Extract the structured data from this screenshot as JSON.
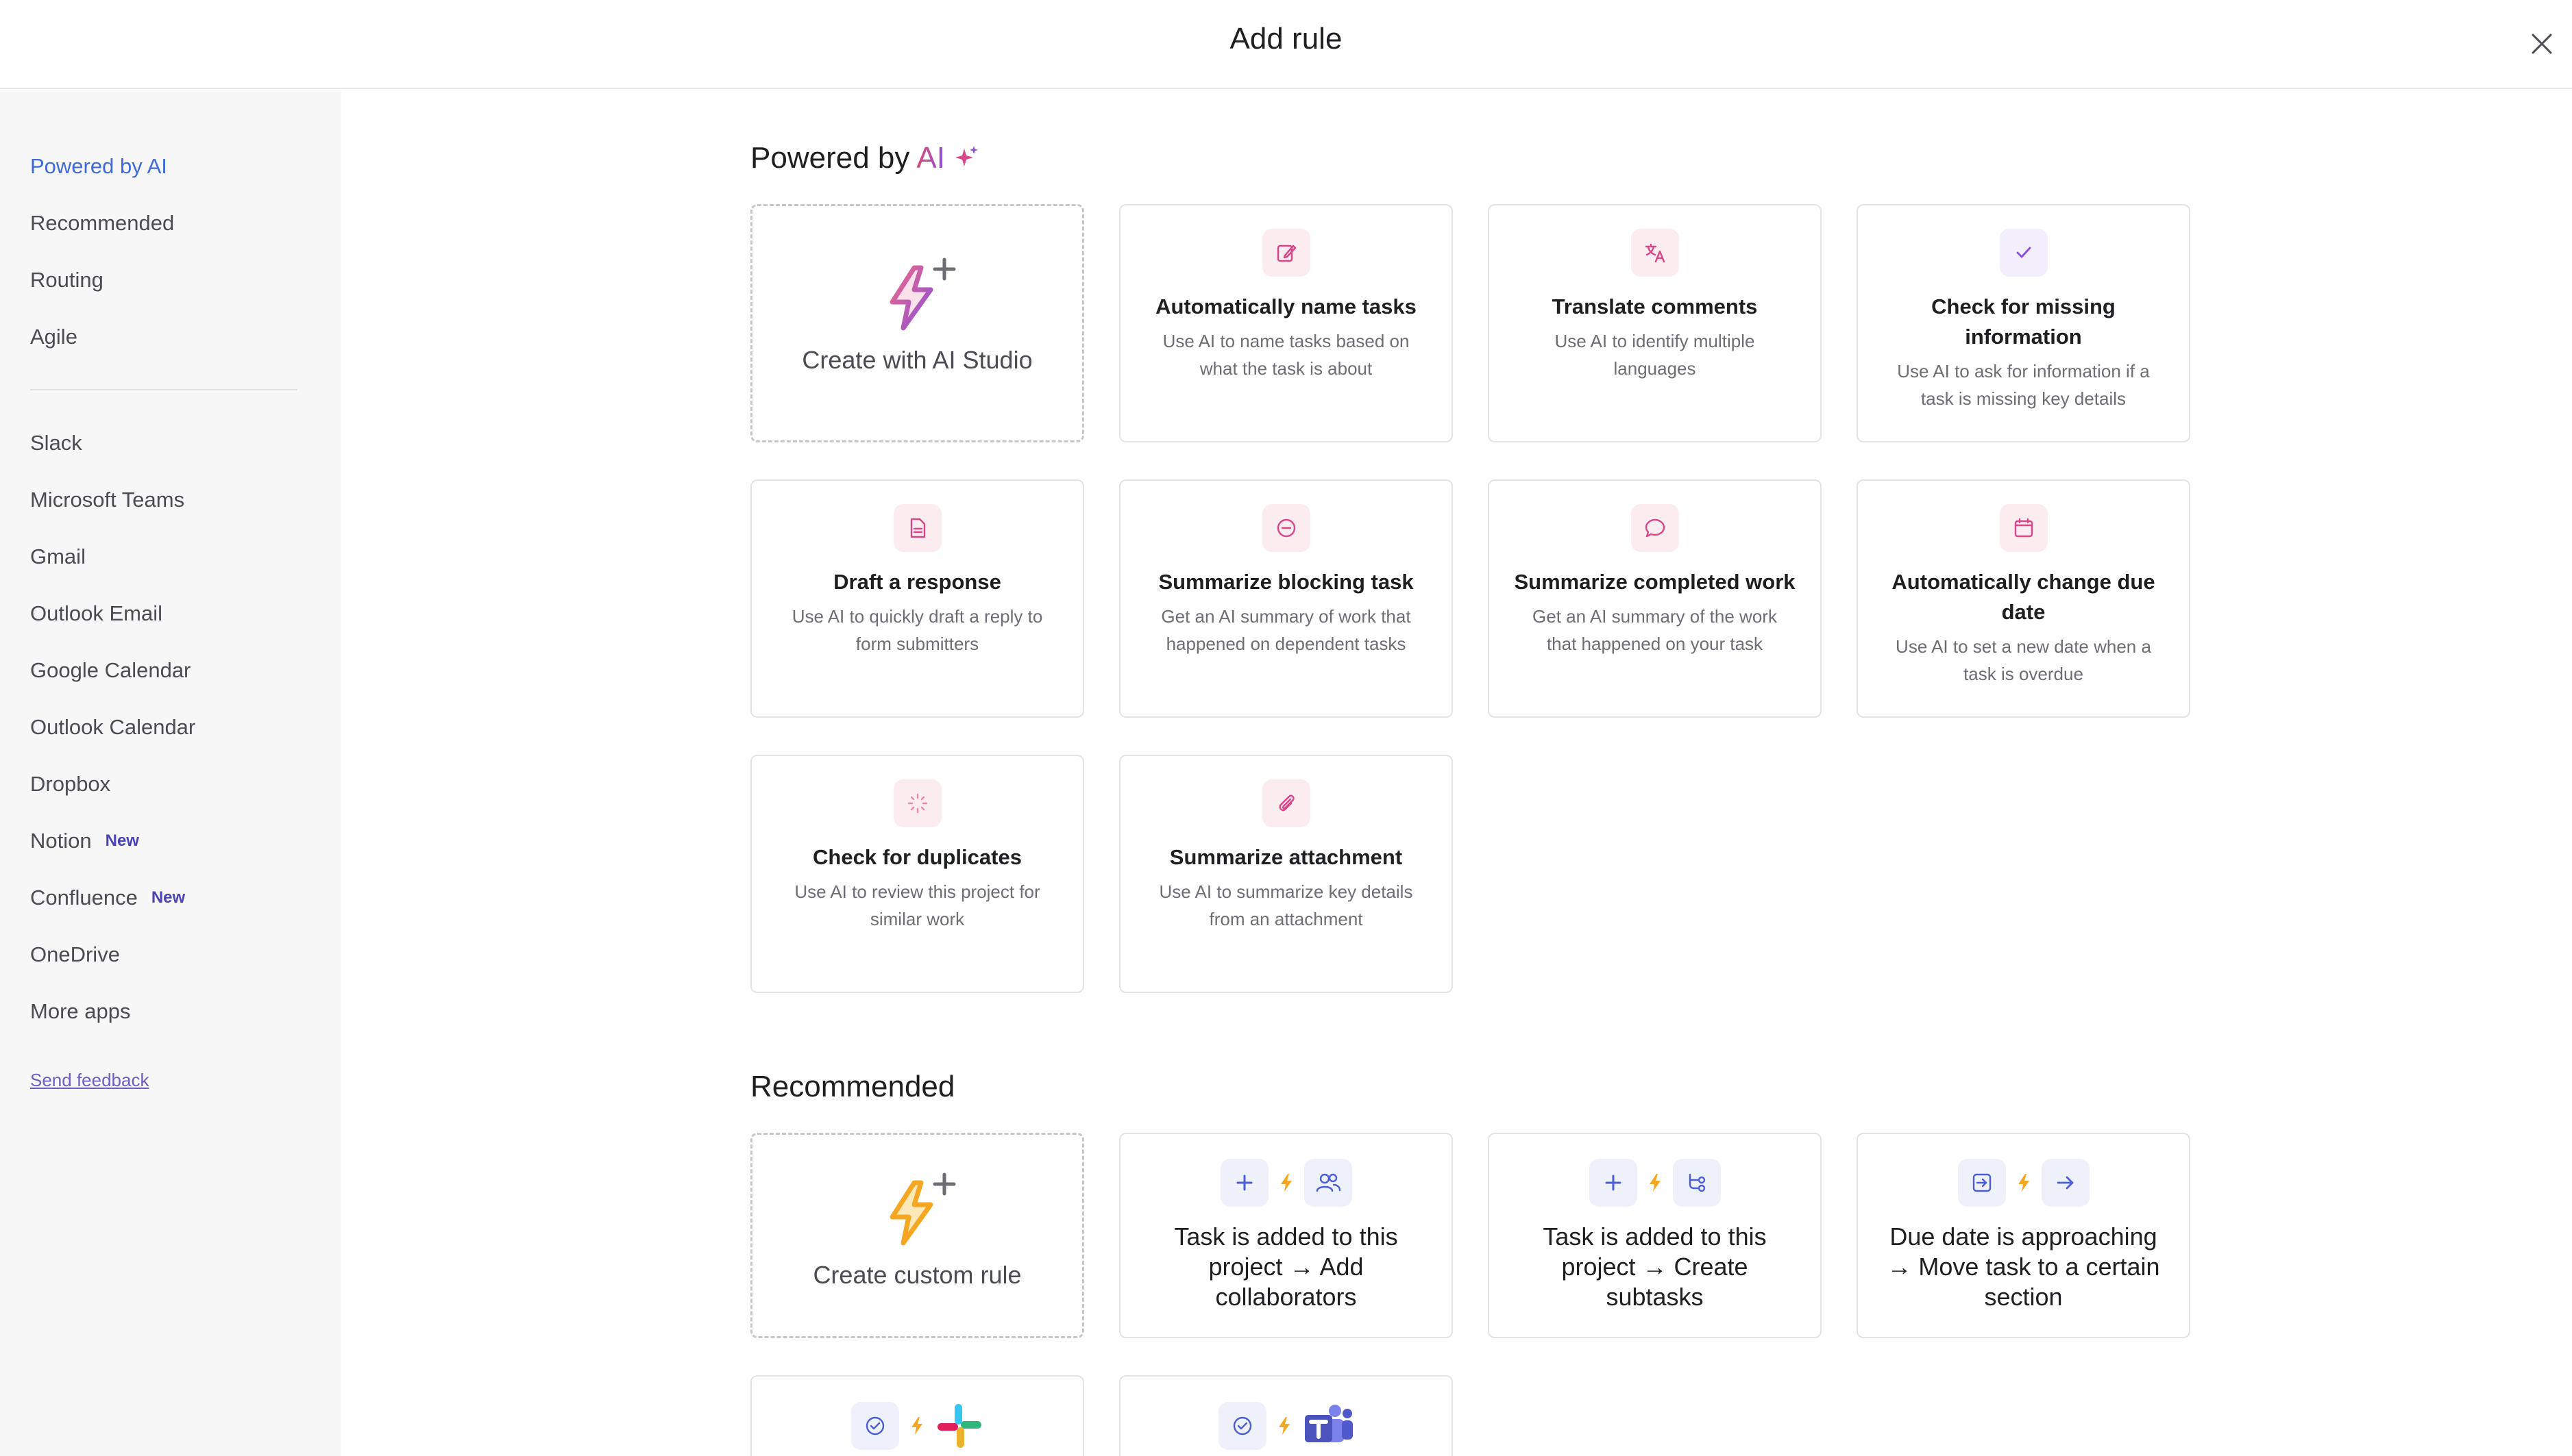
{
  "header": {
    "title": "Add rule"
  },
  "sidebar": {
    "items": [
      {
        "label": "Powered by AI"
      },
      {
        "label": "Recommended"
      },
      {
        "label": "Routing"
      },
      {
        "label": "Agile"
      },
      {
        "label": "Slack"
      },
      {
        "label": "Microsoft Teams"
      },
      {
        "label": "Gmail"
      },
      {
        "label": "Outlook Email"
      },
      {
        "label": "Google Calendar"
      },
      {
        "label": "Outlook Calendar"
      },
      {
        "label": "Dropbox"
      },
      {
        "label": "Notion",
        "badge": "New"
      },
      {
        "label": "Confluence",
        "badge": "New"
      },
      {
        "label": "OneDrive"
      },
      {
        "label": "More apps"
      }
    ],
    "feedback": "Send feedback"
  },
  "ai_section": {
    "title_prefix": "Powered by",
    "title_ai": "AI",
    "create_label": "Create with AI Studio",
    "cards": [
      {
        "title": "Automatically name tasks",
        "desc": "Use AI to name tasks based on what the task is about",
        "icon": "edit-icon"
      },
      {
        "title": "Translate comments",
        "desc": "Use AI to identify multiple languages",
        "icon": "translate-icon"
      },
      {
        "title": "Check for missing information",
        "desc": "Use AI to ask for information if a task is missing key details",
        "icon": "check-icon"
      },
      {
        "title": "Draft a response",
        "desc": "Use AI to quickly draft a reply to form submitters",
        "icon": "document-icon"
      },
      {
        "title": "Summarize blocking task",
        "desc": "Get an AI summary of work that happened on dependent tasks",
        "icon": "blocked-icon"
      },
      {
        "title": "Summarize completed work",
        "desc": "Get an AI summary of the work that happened on your task",
        "icon": "comment-icon"
      },
      {
        "title": "Automatically change due date",
        "desc": "Use AI to set a new date when a task is overdue",
        "icon": "calendar-icon"
      },
      {
        "title": "Check for duplicates",
        "desc": "Use AI to review this project for similar work",
        "icon": "loading-icon"
      },
      {
        "title": "Summarize attachment",
        "desc": "Use AI to summarize key details from an attachment",
        "icon": "paperclip-icon"
      }
    ]
  },
  "recommended_section": {
    "title": "Recommended",
    "create_label": "Create custom rule",
    "cards": [
      {
        "title": "Task is added to this project → Add collaborators"
      },
      {
        "title": "Task is added to this project → Create subtasks"
      },
      {
        "title": "Due date is approaching → Move task to a certain section"
      }
    ]
  },
  "colors": {
    "accent": "#3f6ad8",
    "ai_pink": "#e0477a",
    "bolt_orange": "#f5a623",
    "new_badge": "#4a43b8"
  }
}
